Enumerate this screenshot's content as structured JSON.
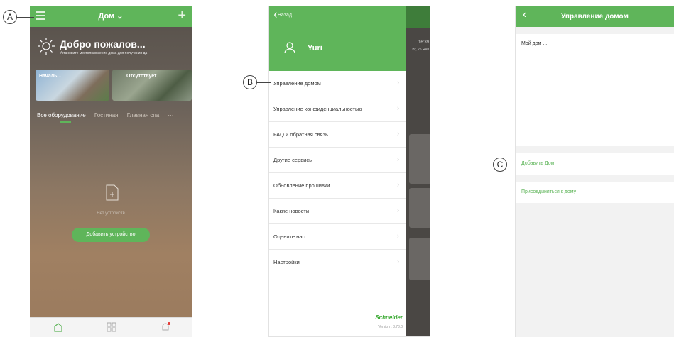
{
  "colors": {
    "accent": "#5fb55a",
    "text": "#333333",
    "muted": "#999999"
  },
  "phone1": {
    "header_title": "Дом ⌄",
    "welcome": "Добро пожалов...",
    "subline": "Установите местоположение дома для получения да",
    "scene_1": "Началь...",
    "scene_2": "Отсутствует",
    "tabs": [
      "Все оборудование",
      "Гостиная",
      "Главная спа"
    ],
    "tabs_more": "···",
    "no_devices": "Нет устройств",
    "add_device": "Добавить устройство",
    "icons": {
      "menu": "hamburger-icon",
      "add": "plus-icon",
      "weather": "sun-icon",
      "home": "home-icon",
      "grid": "grid-icon",
      "notifications": "bell-icon"
    }
  },
  "phone2": {
    "back_label": "❮Назад",
    "user_name": "Yuri",
    "menu_items": [
      "Управление домом",
      "Управление конфиденциальностью",
      "FAQ и обратная связь",
      "Другие сервисы",
      "Обновление прошивки",
      "Какие новости",
      "Оцените нас",
      "Настройки"
    ],
    "background_time": "16:39",
    "background_date": "Вт, 25 Янв",
    "brand": "Schneider",
    "version": "Version : 8.73.0"
  },
  "phone3": {
    "title": "Управление домом",
    "home_item": "Мой дом ...",
    "add_home": "Добавить Дом",
    "join_home": "Присоединяться к дому"
  },
  "callouts": {
    "a": "A",
    "b": "B",
    "c": "C"
  }
}
